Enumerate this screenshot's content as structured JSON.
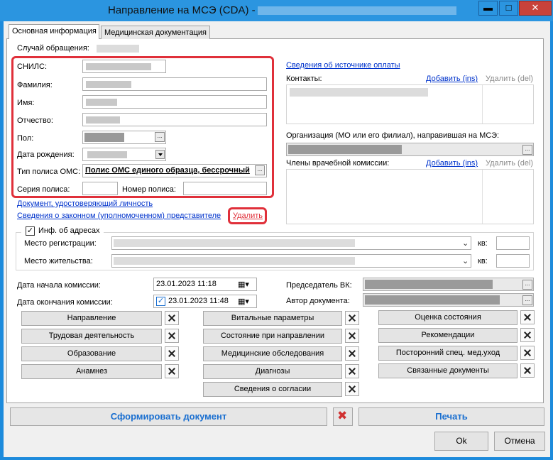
{
  "window": {
    "title": "Направление на МСЭ (CDA) -",
    "minimize_glyph": "▬",
    "maximize_glyph": "□",
    "close_glyph": "✕"
  },
  "tabs": [
    {
      "label": "Основная информация",
      "selected": true
    },
    {
      "label": "Медицинская документация",
      "selected": false
    }
  ],
  "patient": {
    "case_label": "Случай обращения:",
    "snils_label": "СНИЛС:",
    "surname_label": "Фамилия:",
    "name_label": "Имя:",
    "patronymic_label": "Отчество:",
    "sex_label": "Пол:",
    "birthdate_label": "Дата рождения:",
    "policy_type_label": "Тип полиса ОМС:",
    "policy_type_value": "Полис ОМС единого образца, бессрочный",
    "policy_series_label": "Серия полиса:",
    "policy_number_label": "Номер полиса:",
    "identity_doc_link": "Документ, удостоверяющий личность",
    "representative_link": "Сведения о законном (уполномоченном) представителе",
    "delete_link": "Удалить"
  },
  "right_panel": {
    "payment_source_link": "Сведения об источнике оплаты",
    "contacts_label": "Контакты:",
    "add_link": "Добавить (ins)",
    "delete_link": "Удалить (del)",
    "organization_label": "Организация (МО или его филиал), направившая на МСЭ:",
    "commission_label": "Члены врачебной комиссии:"
  },
  "address": {
    "checkbox_label": "Инф. об адресах",
    "checked": true,
    "registration_label": "Место регистрации:",
    "residence_label": "Место жительства:",
    "apt_label": "кв:"
  },
  "commission": {
    "start_label": "Дата начала комиссии:",
    "start_value": "23.01.2023 11:18",
    "end_label": "Дата окончания комиссии:",
    "end_value": "23.01.2023 11:48",
    "end_checked": true,
    "chairman_label": "Председатель ВК:",
    "author_label": "Автор документа:"
  },
  "sections": {
    "col1": [
      "Направление",
      "Трудовая деятельность",
      "Образование",
      "Анамнез"
    ],
    "col2": [
      "Витальные параметры",
      "Состояние при направлении",
      "Медицинские обследования",
      "Диагнозы",
      "Сведения о согласии"
    ],
    "col3": [
      "Оценка состояния",
      "Рекомендации",
      "Посторонний спец. мед.уход",
      "Связанные документы"
    ]
  },
  "footer": {
    "generate_label": "Сформировать документ",
    "print_label": "Печать",
    "ok_label": "Ok",
    "cancel_label": "Отмена"
  },
  "colors": {
    "title_bar": "#2b95e0",
    "highlight": "#e0303a",
    "link": "#0033cc",
    "big_button_text": "#1a6fd0"
  }
}
